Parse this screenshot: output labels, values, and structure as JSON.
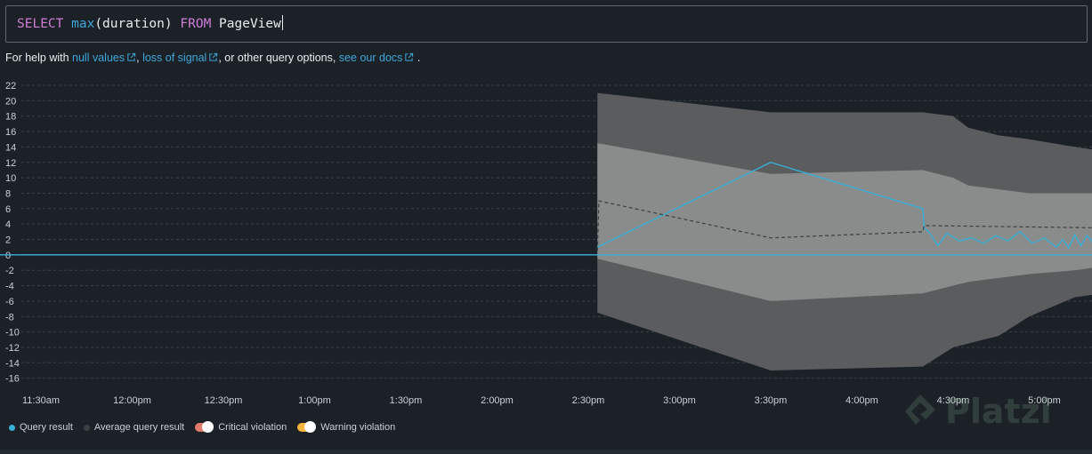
{
  "query": {
    "select_kw": "SELECT",
    "fn": "max",
    "arg": "(duration)",
    "from_kw": "FROM",
    "table": "PageView"
  },
  "help": {
    "prefix": "For help with ",
    "link1": "null values",
    "sep1": ", ",
    "link2": "loss of signal",
    "sep2": ", or other query options, ",
    "link3": "see our docs",
    "suffix": "."
  },
  "legend": {
    "query_result": "Query result",
    "average_query_result": "Average query result",
    "critical_violation": "Critical violation",
    "warning_violation": "Warning violation"
  },
  "colors": {
    "query_result": "#38b0d8",
    "average": "#3a3f43",
    "critical": "#e07a6a",
    "warning": "#f2b43a",
    "band_outer": "#5a5c5d",
    "band_inner": "#8a8b8b"
  },
  "watermark_text": "Platzi",
  "chart_data": {
    "type": "line",
    "x_tick_labels": [
      "11:30am",
      "12:00pm",
      "12:30pm",
      "1:00pm",
      "1:30pm",
      "2:00pm",
      "2:30pm",
      "3:00pm",
      "3:30pm",
      "4:00pm",
      "4:30pm",
      "5:00pm"
    ],
    "y_ticks": [
      22,
      20,
      18,
      16,
      14,
      12,
      10,
      8,
      6,
      4,
      2,
      0,
      -2,
      -4,
      -6,
      -8,
      -10,
      -12,
      -14,
      -16
    ],
    "ylim": [
      -16,
      22
    ],
    "x_range_minutes": [
      -17,
      339
    ],
    "grid": true,
    "series": [
      {
        "name": "Query result",
        "x": [
          -17,
          0,
          30,
          60,
          90,
          120,
          150,
          183,
          210,
          240,
          270,
          279,
          286,
          289,
          292,
          296,
          300,
          306,
          312,
          317,
          323,
          330,
          334,
          338,
          343,
          347,
          353,
          356,
          361,
          363,
          366,
          372,
          376,
          378,
          383,
          387,
          390
        ],
        "y": [
          0,
          0,
          0,
          0,
          0,
          0,
          0,
          0,
          0,
          0,
          0,
          0,
          0,
          0,
          0,
          0,
          0,
          0,
          0,
          0,
          0,
          0,
          0,
          0,
          0,
          0,
          0,
          0,
          0,
          0,
          0,
          0,
          0,
          0,
          0,
          0,
          0
        ]
      },
      {
        "name": "Query result",
        "x": [
          183,
          240,
          290,
          290.5,
          292,
          295,
          298,
          302,
          306,
          310,
          314,
          318,
          322,
          326,
          330,
          334,
          336,
          338,
          340,
          342,
          344,
          346,
          348,
          349
        ],
        "y": [
          1,
          12,
          6,
          3.5,
          3,
          1.2,
          2.8,
          1.8,
          2.2,
          1.5,
          2.5,
          1.8,
          3,
          1.5,
          2.2,
          1,
          2,
          0.9,
          2.6,
          1.2,
          2.5,
          1.6,
          4,
          1.8
        ]
      },
      {
        "name": "Average query result",
        "x": [
          183,
          183.5,
          240,
          290,
          290.5,
          349
        ],
        "y": [
          0.5,
          7,
          2.2,
          3,
          3.8,
          3.5
        ]
      }
    ],
    "bands": [
      {
        "kind": "outer",
        "upper_x": [
          183,
          240,
          290,
          300,
          305,
          315,
          325,
          340,
          349
        ],
        "upper": [
          21,
          18.5,
          18.5,
          18,
          16.5,
          15.5,
          15,
          14,
          13.5
        ],
        "lower_x": [
          183,
          240,
          290,
          300,
          305,
          315,
          325,
          340,
          349
        ],
        "lower": [
          -7.5,
          -15,
          -14.5,
          -12,
          -11.5,
          -10.5,
          -8,
          -5.5,
          -5
        ]
      },
      {
        "kind": "inner",
        "upper_x": [
          183,
          240,
          290,
          300,
          305,
          315,
          325,
          340,
          349
        ],
        "upper": [
          14.5,
          10.5,
          11,
          10,
          9,
          8.5,
          8,
          8,
          8
        ],
        "lower_x": [
          183,
          240,
          290,
          300,
          305,
          315,
          325,
          340,
          349
        ],
        "lower": [
          -0.5,
          -6,
          -5,
          -4,
          -3.5,
          -3,
          -2.5,
          -2,
          -1.5
        ]
      }
    ]
  }
}
